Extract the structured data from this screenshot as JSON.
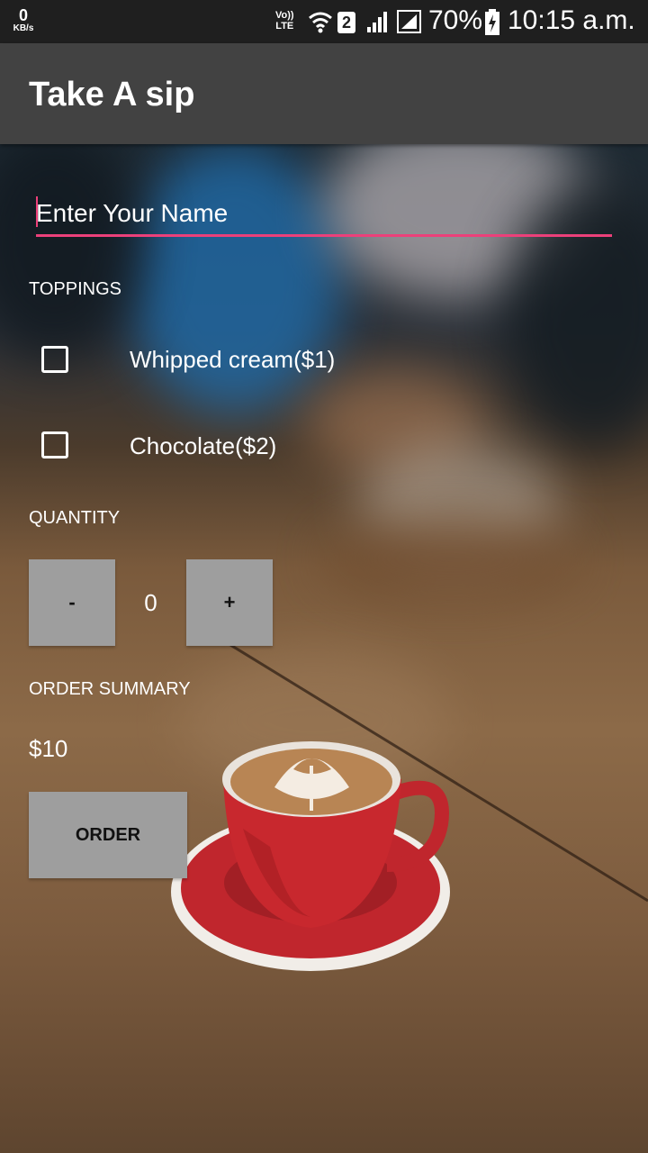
{
  "status_bar": {
    "net_speed_value": "0",
    "net_speed_unit": "KB/s",
    "volte_top": "Vo))",
    "volte_bottom": "LTE",
    "sim_badge": "2",
    "battery_percent": "70%",
    "time": "10:15 a.m.",
    "icons": [
      "wifi-icon",
      "signal-icon",
      "signal-icon",
      "battery-charging-icon"
    ]
  },
  "app_bar": {
    "title": "Take A sip",
    "background": "#424242"
  },
  "form": {
    "name_placeholder": "Enter Your Name",
    "name_value": "",
    "accent_color": "#ec407a",
    "toppings_label": "TOPPINGS",
    "toppings": [
      {
        "label": "Whipped cream($1)",
        "checked": false
      },
      {
        "label": "Chocolate($2)",
        "checked": false
      }
    ],
    "quantity_label": "QUANTITY",
    "decrement_label": "-",
    "quantity_value": "0",
    "increment_label": "+",
    "summary_label": "ORDER SUMMARY",
    "summary_price": "$10",
    "order_label": "ORDER",
    "button_color": "#9e9e9e"
  }
}
